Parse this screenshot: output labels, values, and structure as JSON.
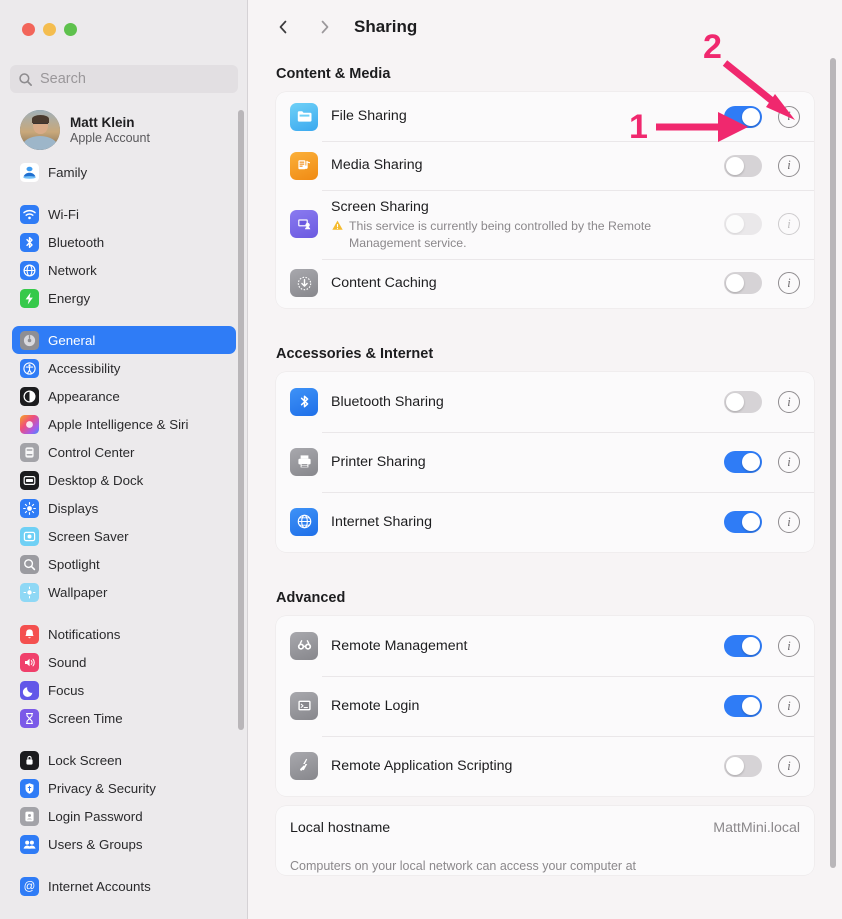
{
  "window": {
    "traffic_lights": [
      "close",
      "minimize",
      "zoom"
    ]
  },
  "sidebar": {
    "search": {
      "placeholder": "Search",
      "value": "",
      "icon": "search-icon"
    },
    "account": {
      "name": "Matt Klein",
      "subtitle": "Apple Account",
      "avatar": "user-avatar"
    },
    "groups": [
      {
        "items": [
          {
            "label": "Family",
            "icon": "family-icon"
          }
        ]
      },
      {
        "items": [
          {
            "label": "Wi-Fi",
            "icon": "wifi-icon"
          },
          {
            "label": "Bluetooth",
            "icon": "bluetooth-icon"
          },
          {
            "label": "Network",
            "icon": "network-icon"
          },
          {
            "label": "Energy",
            "icon": "energy-icon"
          }
        ]
      },
      {
        "items": [
          {
            "label": "General",
            "icon": "general-icon",
            "selected": true
          },
          {
            "label": "Accessibility",
            "icon": "accessibility-icon"
          },
          {
            "label": "Appearance",
            "icon": "appearance-icon"
          },
          {
            "label": "Apple Intelligence & Siri",
            "icon": "apple-intelligence-icon"
          },
          {
            "label": "Control Center",
            "icon": "control-center-icon"
          },
          {
            "label": "Desktop & Dock",
            "icon": "desktop-dock-icon"
          },
          {
            "label": "Displays",
            "icon": "displays-icon"
          },
          {
            "label": "Screen Saver",
            "icon": "screen-saver-icon"
          },
          {
            "label": "Spotlight",
            "icon": "spotlight-icon"
          },
          {
            "label": "Wallpaper",
            "icon": "wallpaper-icon"
          }
        ]
      },
      {
        "items": [
          {
            "label": "Notifications",
            "icon": "notifications-icon"
          },
          {
            "label": "Sound",
            "icon": "sound-icon"
          },
          {
            "label": "Focus",
            "icon": "focus-icon"
          },
          {
            "label": "Screen Time",
            "icon": "screen-time-icon"
          }
        ]
      },
      {
        "items": [
          {
            "label": "Lock Screen",
            "icon": "lock-screen-icon"
          },
          {
            "label": "Privacy & Security",
            "icon": "privacy-security-icon"
          },
          {
            "label": "Login Password",
            "icon": "login-password-icon"
          },
          {
            "label": "Users & Groups",
            "icon": "users-groups-icon"
          }
        ]
      },
      {
        "items": [
          {
            "label": "Internet Accounts",
            "icon": "internet-accounts-icon"
          }
        ]
      }
    ]
  },
  "toolbar": {
    "back": "chevron-left-icon",
    "forward": "chevron-right-icon",
    "title": "Sharing"
  },
  "sections": [
    {
      "title": "Content & Media",
      "rows": [
        {
          "label": "File Sharing",
          "icon": "file-sharing-icon",
          "toggle": "on",
          "info": "info-button"
        },
        {
          "label": "Media Sharing",
          "icon": "media-sharing-icon",
          "toggle": "off",
          "info": "info-button"
        },
        {
          "label": "Screen Sharing",
          "icon": "screen-sharing-icon",
          "toggle": "off",
          "disabled": true,
          "info": "info-button",
          "note": "This service is currently being controlled by the Remote Management service.",
          "note_icon": "warning-icon"
        },
        {
          "label": "Content Caching",
          "icon": "content-caching-icon",
          "toggle": "off",
          "info": "info-button"
        }
      ]
    },
    {
      "title": "Accessories & Internet",
      "rows": [
        {
          "label": "Bluetooth Sharing",
          "icon": "bluetooth-sharing-icon",
          "toggle": "off",
          "info": "info-button"
        },
        {
          "label": "Printer Sharing",
          "icon": "printer-sharing-icon",
          "toggle": "on",
          "info": "info-button"
        },
        {
          "label": "Internet Sharing",
          "icon": "internet-sharing-icon",
          "toggle": "on",
          "info": "info-button"
        }
      ]
    },
    {
      "title": "Advanced",
      "rows": [
        {
          "label": "Remote Management",
          "icon": "remote-management-icon",
          "toggle": "on",
          "info": "info-button"
        },
        {
          "label": "Remote Login",
          "icon": "remote-login-icon",
          "toggle": "on",
          "info": "info-button"
        },
        {
          "label": "Remote Application Scripting",
          "icon": "remote-app-scripting-icon",
          "toggle": "off",
          "info": "info-button"
        }
      ]
    }
  ],
  "hostname": {
    "label": "Local hostname",
    "value": "MattMini.local",
    "description": "Computers on your local network can access your computer at"
  },
  "annotations": [
    {
      "number": "1",
      "target": "file-sharing-toggle",
      "color": "#f0286e"
    },
    {
      "number": "2",
      "target": "file-sharing-info-button",
      "color": "#f0286e"
    }
  ],
  "colors": {
    "accent_blue": "#2f7cf6",
    "annotation_pink": "#f0286e",
    "sidebar_bg": "#eceaec",
    "main_bg": "#f7f4f5"
  }
}
